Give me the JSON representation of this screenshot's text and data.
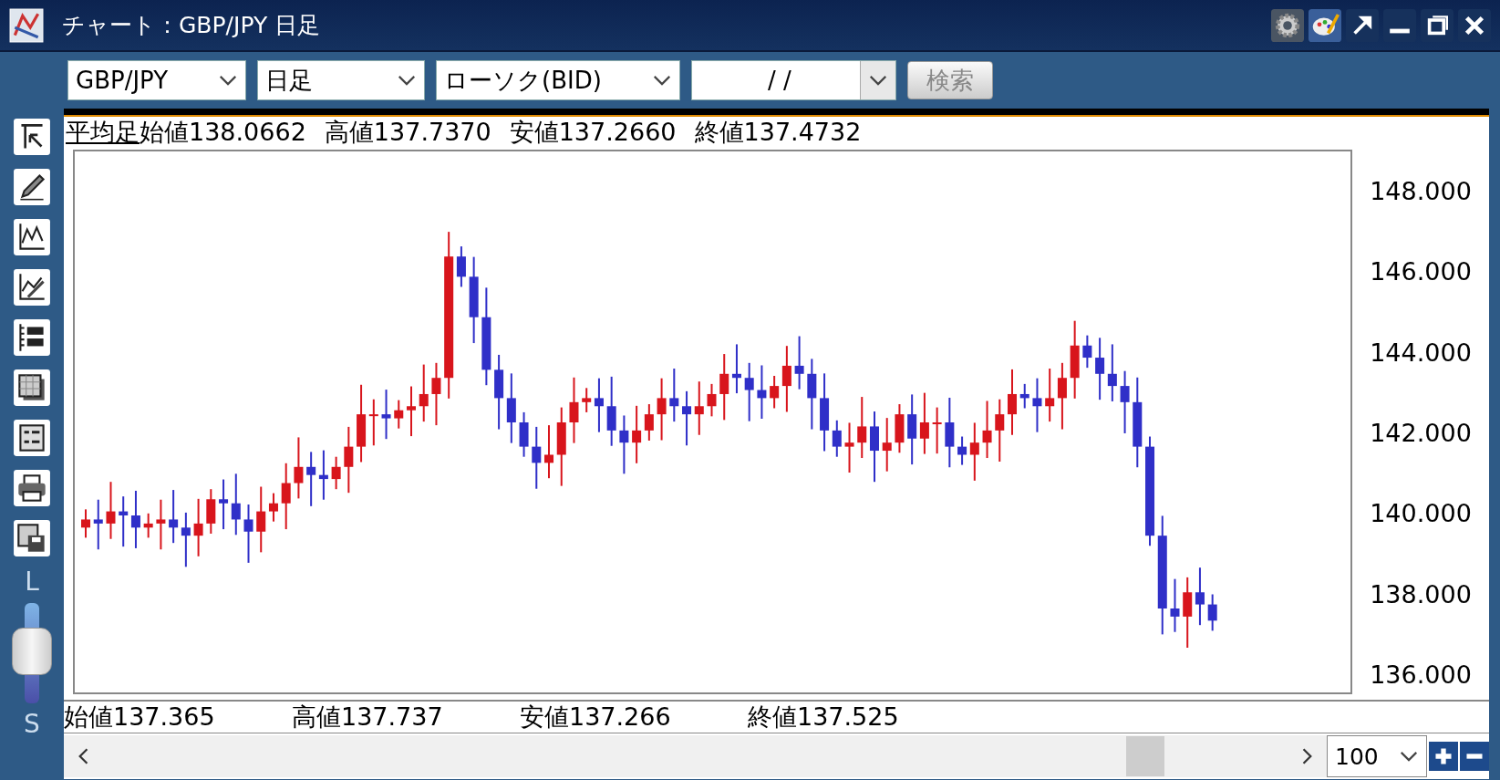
{
  "window": {
    "title": "チャート：GBP/JPY 日足"
  },
  "toolbar": {
    "symbol": "GBP/JPY",
    "period": "日足",
    "chart_type": "ローソク(BID)",
    "date": "/ /",
    "search_button": "検索"
  },
  "info_line": {
    "label": "平均足",
    "values": [
      "始値138.0662",
      "高値137.7370",
      "安値137.2660",
      "終値137.4732"
    ]
  },
  "y_axis_labels": [
    "148.000",
    "146.000",
    "144.000",
    "142.000",
    "140.000",
    "138.000",
    "136.000"
  ],
  "ohlc": [
    "始値137.365",
    "高値137.737",
    "安値137.266",
    "終値137.525"
  ],
  "zoom_slider": {
    "top_label": "L",
    "bottom_label": "S",
    "level": 0.55
  },
  "bar_count": "100"
}
